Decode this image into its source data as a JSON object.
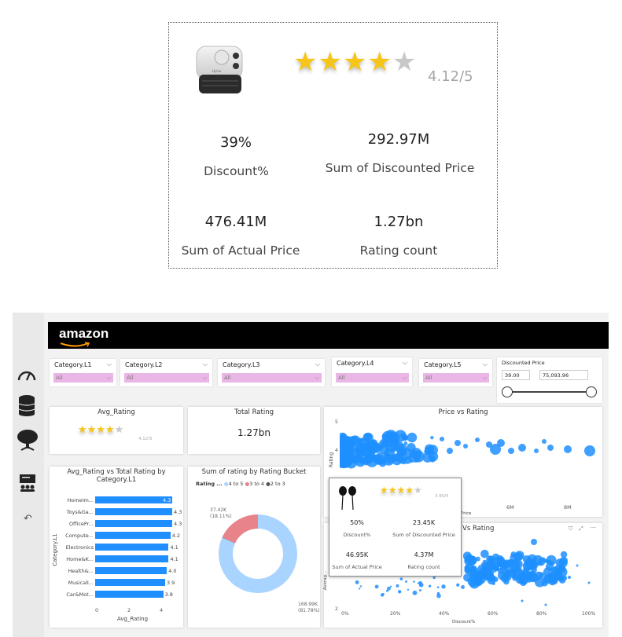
{
  "top_card": {
    "rating_text": "4.12/5",
    "rating_value": 4.12,
    "kpis": [
      {
        "value": "39%",
        "label": "Discount%"
      },
      {
        "value": "292.97M",
        "label": "Sum of Discounted Price"
      },
      {
        "value": "476.41M",
        "label": "Sum of Actual Price"
      },
      {
        "value": "1.27bn",
        "label": "Rating count"
      }
    ]
  },
  "dashboard": {
    "brand": "amazon",
    "slicers": [
      {
        "title": "Category.L1",
        "value": "All"
      },
      {
        "title": "Category.L2",
        "value": "All"
      },
      {
        "title": "Category.L3",
        "value": "All"
      },
      {
        "title": "Category.L4",
        "value": "All"
      },
      {
        "title": "Category.L5",
        "value": "All"
      }
    ],
    "price_slicer": {
      "title": "Discounted Price",
      "min": "39.00",
      "max": "75,093.96"
    },
    "avg_rating_card": {
      "title": "Avg_Rating",
      "rating_text": "4.12/5",
      "rating_value": 4.12
    },
    "total_rating_card": {
      "title": "Total Rating",
      "value": "1.27bn"
    },
    "bar_chart": {
      "title": "Avg_Rating vs Total Rating by Category.L1",
      "ylabel": "Category.L1",
      "xlabel": "Avg_Rating",
      "xticks": [
        "0",
        "2",
        "4"
      ]
    },
    "donut_chart": {
      "title": "Sum of rating by Rating Bucket",
      "legend_title": "Rating ...",
      "legend": [
        "4 to 5",
        "3 to 4",
        "2 to 3"
      ],
      "label_small_value": "37.42K",
      "label_small_pct": "(18.11%)",
      "label_large_value": "168.99K",
      "label_large_pct": "(81.78%)"
    },
    "scatter1": {
      "title": "Price vs Rating",
      "ylabel": "Rating",
      "yticks": [
        "5",
        "4"
      ],
      "xticks": [
        "6M",
        "8M"
      ],
      "xlabel": "Price"
    },
    "scatter2": {
      "title": "Vs Rating",
      "ylabel": "Averag...",
      "ytick_bottom": "2",
      "xticks": [
        "0%",
        "20%",
        "40%",
        "60%",
        "80%",
        "100%"
      ],
      "xlabel": "Discount%"
    },
    "tooltip": {
      "rating_text": "3.90/5",
      "rating_value": 3.9,
      "items": [
        {
          "value": "50%",
          "label": "Discount%"
        },
        {
          "value": "23.45K",
          "label": "Sum of Discounted Price"
        },
        {
          "value": "46.95K",
          "label": "Sum of Actual Price"
        },
        {
          "value": "4.37M",
          "label": "Rating count"
        }
      ]
    }
  },
  "chart_data": [
    {
      "type": "bar",
      "title": "Avg_Rating vs Total Rating by Category.L1",
      "xlabel": "Avg_Rating",
      "ylabel": "Category.L1",
      "categories": [
        "HomeIm...",
        "Toys&Ga...",
        "OfficePr...",
        "Compute...",
        "Electronics",
        "Home&K...",
        "Health&...",
        "MusicalI...",
        "Car&Mot..."
      ],
      "values": [
        4.3,
        4.3,
        4.3,
        4.2,
        4.1,
        4.1,
        4.0,
        3.9,
        3.8
      ],
      "xlim": [
        0,
        4.3
      ],
      "color": "#1f8fff"
    },
    {
      "type": "pie",
      "title": "Sum of rating by Rating Bucket",
      "categories": [
        "4 to 5",
        "3 to 4",
        "2 to 3"
      ],
      "values": [
        168990,
        37420,
        230
      ],
      "colors": [
        "#a9d4ff",
        "#e9838a",
        "#555555"
      ]
    }
  ],
  "colors": {
    "accent_blue": "#1f8fff",
    "slicer_pink": "#e9b6e6",
    "star_gold": "#f5c518",
    "donut_blue": "#a9d4ff",
    "donut_red": "#e9838a"
  },
  "icons": {
    "sidebar": [
      "speedometer-icon",
      "database-icon",
      "tree-icon",
      "presentation-icon",
      "undo-icon"
    ]
  }
}
